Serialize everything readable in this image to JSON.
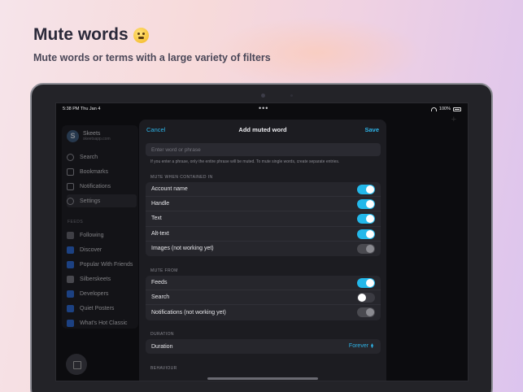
{
  "promo": {
    "title": "Mute words",
    "subtitle": "Mute words or terms with a large variety of filters"
  },
  "status": {
    "time": "5:38 PM  Thu Jan 4",
    "battery": "100%"
  },
  "sidebar": {
    "profile_name": "Skeets",
    "profile_handle": "skeetsapp.com",
    "items": [
      {
        "label": "Search"
      },
      {
        "label": "Bookmarks"
      },
      {
        "label": "Notifications"
      },
      {
        "label": "Settings"
      }
    ],
    "feeds_label": "FEEDS",
    "feeds": [
      {
        "label": "Following",
        "color": "#6a6a72"
      },
      {
        "label": "Discover",
        "color": "#2a6ee0"
      },
      {
        "label": "Popular With Friends",
        "color": "#2a6ee0"
      },
      {
        "label": "Silberskeets",
        "color": "#7a7a82"
      },
      {
        "label": "Developers",
        "color": "#2a6ee0"
      },
      {
        "label": "Quiet Posters",
        "color": "#2a6ee0"
      },
      {
        "label": "What's Hot Classic",
        "color": "#2a6ee0"
      }
    ]
  },
  "modal": {
    "cancel": "Cancel",
    "title": "Add muted word",
    "save": "Save",
    "input_placeholder": "Enter word or phrase",
    "hint": "If you enter a phrase, only the entire phrase will be muted. To mute single words, create separate entries.",
    "contained_label": "MUTE WHEN CONTAINED IN",
    "contained": [
      {
        "label": "Account name",
        "state": "on"
      },
      {
        "label": "Handle",
        "state": "on"
      },
      {
        "label": "Text",
        "state": "on"
      },
      {
        "label": "Alt-text",
        "state": "on"
      },
      {
        "label": "Images (not working yet)",
        "state": "disabled"
      }
    ],
    "from_label": "MUTE FROM",
    "from": [
      {
        "label": "Feeds",
        "state": "on"
      },
      {
        "label": "Search",
        "state": "off"
      },
      {
        "label": "Notifications (not working yet)",
        "state": "disabled"
      }
    ],
    "duration_label": "DURATION",
    "duration_row": "Duration",
    "duration_value": "Forever",
    "behaviour_label": "BEHAVIOUR"
  },
  "colors": {
    "accent": "#2eb4e8",
    "toggle_on": "#23b8ea"
  }
}
